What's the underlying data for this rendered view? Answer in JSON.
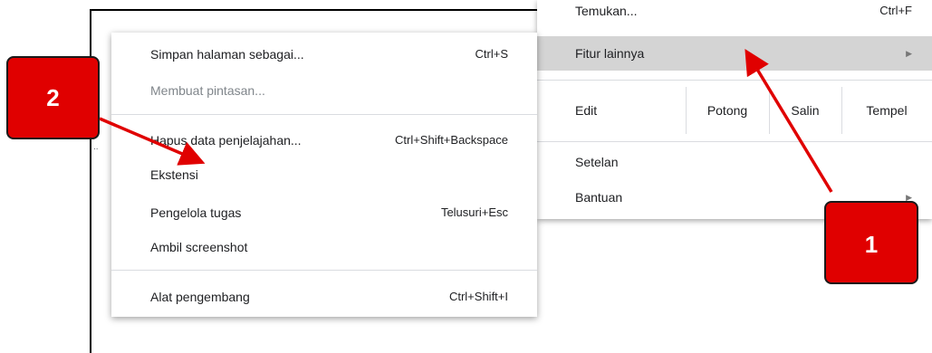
{
  "main_menu": {
    "find_label": "Temukan...",
    "find_shortcut": "Ctrl+F",
    "more_tools_label": "Fitur lainnya",
    "more_tools_arrow": "▶",
    "edit": {
      "label": "Edit",
      "cut": "Potong",
      "copy": "Salin",
      "paste": "Tempel"
    },
    "settings_label": "Setelan",
    "help_label": "Bantuan",
    "help_arrow": "▶"
  },
  "submenu": {
    "items": [
      {
        "label": "Simpan halaman sebagai...",
        "shortcut": "Ctrl+S"
      },
      {
        "label": "Membuat pintasan...",
        "shortcut": ""
      },
      {
        "label": "Hapus data penjelajahan...",
        "shortcut": "Ctrl+Shift+Backspace"
      },
      {
        "label": "Ekstensi",
        "shortcut": ""
      },
      {
        "label": "Pengelola tugas",
        "shortcut": "Telusuri+Esc"
      },
      {
        "label": "Ambil screenshot",
        "shortcut": ""
      },
      {
        "label": "Alat pengembang",
        "shortcut": "Ctrl+Shift+I"
      }
    ]
  },
  "callouts": {
    "one": "1",
    "two": "2"
  },
  "edge_dots": "..",
  "colors": {
    "highlight": "#d4d4d4",
    "callout": "#e00000",
    "separator": "#dadce0"
  }
}
